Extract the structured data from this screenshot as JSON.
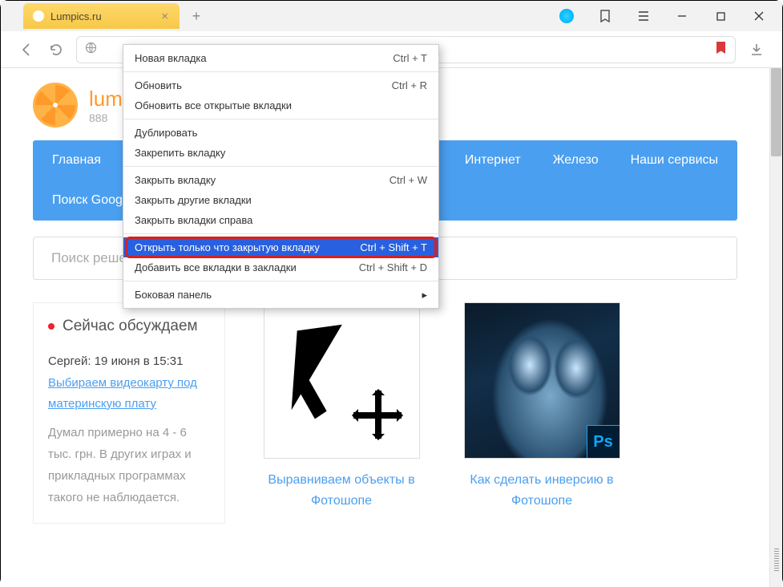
{
  "tab": {
    "title": "Lumpics.ru"
  },
  "context_menu": {
    "items": [
      {
        "label": "Новая вкладка",
        "shortcut": "Ctrl + T"
      },
      {
        "label": "Обновить",
        "shortcut": "Ctrl + R"
      },
      {
        "label": "Обновить все открытые вкладки"
      },
      {
        "label": "Дублировать"
      },
      {
        "label": "Закрепить вкладку"
      },
      {
        "label": "Закрыть вкладку",
        "shortcut": "Ctrl + W"
      },
      {
        "label": "Закрыть другие вкладки"
      },
      {
        "label": "Закрыть вкладки справа"
      },
      {
        "label": "Открыть только что закрытую вкладку",
        "shortcut": "Ctrl + Shift + T",
        "highlighted": true
      },
      {
        "label": "Добавить все вкладки в закладки",
        "shortcut": "Ctrl + Shift + D"
      },
      {
        "label": "Боковая панель",
        "submenu": true
      }
    ]
  },
  "site": {
    "brand": "lumpics",
    "tagline": "888"
  },
  "nav": {
    "row1": [
      "Главная",
      "Интернет",
      "Железо",
      "Наши сервисы"
    ],
    "row2": [
      "Поиск Google"
    ]
  },
  "search": {
    "placeholder": "Поиск решения..."
  },
  "discussion": {
    "title": "Сейчас обсуждаем",
    "author": "Сергей: 19 июня в 15:31",
    "link": "Выбираем видеокарту под материнскую плату",
    "body": "Думал примерно на 4 - 6 тыс. грн. В других играх и прикладных программах такого не наблюдается."
  },
  "cards": [
    {
      "title": "Выравниваем объекты в Фотошопе"
    },
    {
      "title": "Как сделать инверсию в Фотошопе",
      "badge": "Ps"
    }
  ]
}
